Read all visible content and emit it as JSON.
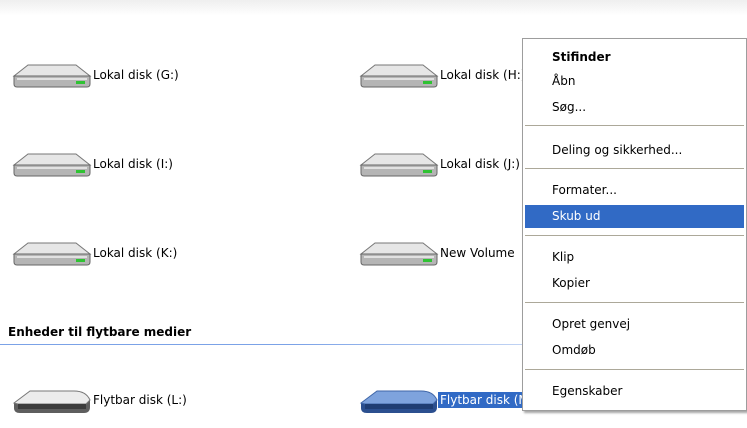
{
  "drives": [
    {
      "label": "Lokal disk (G:)",
      "kind": "hard-disk"
    },
    {
      "label": "Lokal disk (H:)",
      "kind": "hard-disk"
    },
    {
      "label": "Lokal disk (I:)",
      "kind": "hard-disk"
    },
    {
      "label": "Lokal disk (J:)",
      "kind": "hard-disk"
    },
    {
      "label": "Lokal disk (K:)",
      "kind": "hard-disk"
    },
    {
      "label": "New Volume",
      "kind": "hard-disk"
    }
  ],
  "removable_group": {
    "header": "Enheder til flytbare medier",
    "drives": [
      {
        "label": "Flytbar disk (L:)",
        "kind": "removable-disk",
        "selected": false
      },
      {
        "label": "Flytbar disk (M:)",
        "kind": "removable-disk",
        "selected": true
      }
    ]
  },
  "context_menu": {
    "items": [
      {
        "label": "Stifinder",
        "bold": true
      },
      {
        "label": "Åbn"
      },
      {
        "label": "Søg..."
      },
      {
        "separator": true
      },
      {
        "label": "Deling og sikkerhed..."
      },
      {
        "separator": true
      },
      {
        "label": "Formater..."
      },
      {
        "label": "Skub ud",
        "highlighted": true
      },
      {
        "separator": true
      },
      {
        "label": "Klip"
      },
      {
        "label": "Kopier"
      },
      {
        "separator": true
      },
      {
        "label": "Opret genvej"
      },
      {
        "label": "Omdøb"
      },
      {
        "separator": true
      },
      {
        "label": "Egenskaber"
      }
    ]
  },
  "colors": {
    "selection": "#316ac5",
    "group_line": "#7ba2e7",
    "menu_border": "#9d9d9d",
    "removable_selected_icon": "#5b84c9"
  }
}
